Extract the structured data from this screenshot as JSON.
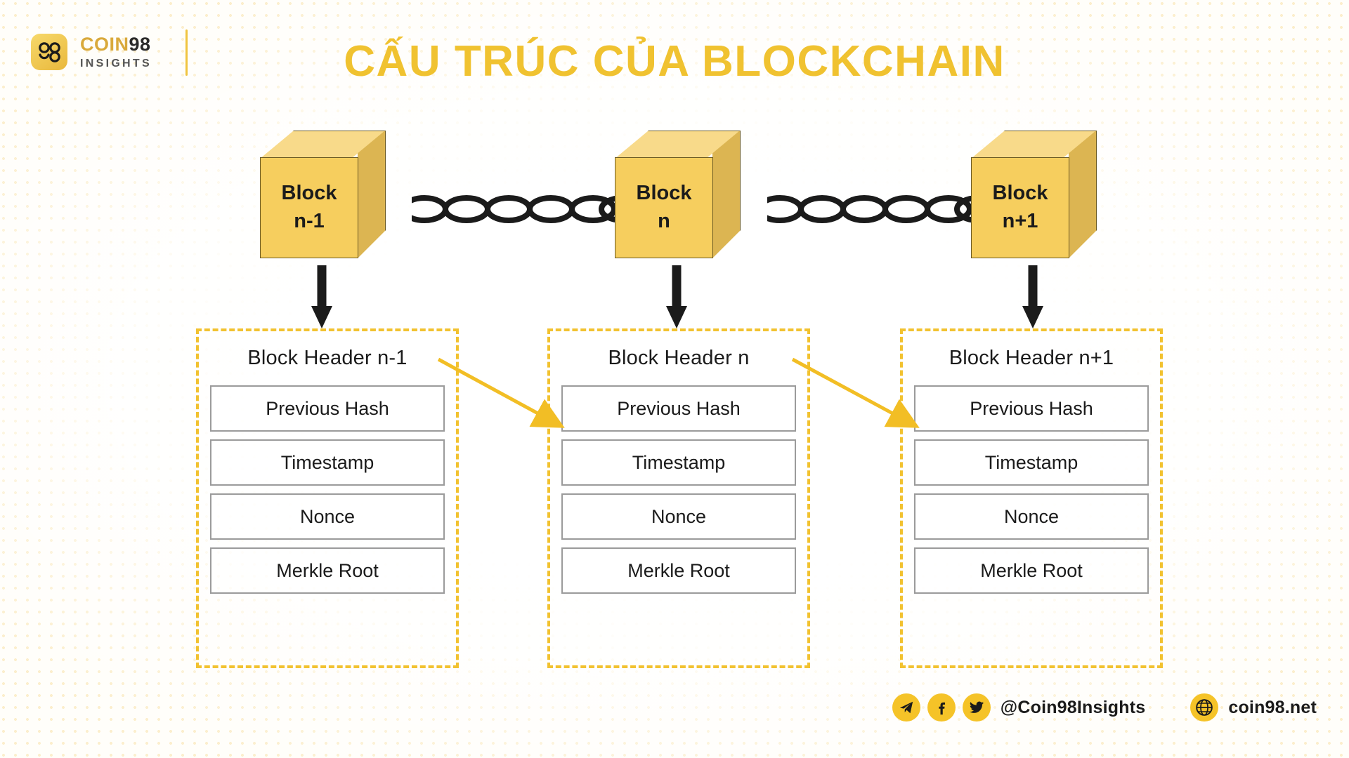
{
  "brand": {
    "logo_title_word": "COIN",
    "logo_title_num": "98",
    "logo_subtitle": "INSIGHTS",
    "logo_glyph": "98"
  },
  "header": {
    "title": "CẤU TRÚC CỦA BLOCKCHAIN"
  },
  "colors": {
    "accent": "#F0C230",
    "block_front": "#F6CE5E",
    "block_top": "#F8DA8A",
    "block_side": "#DCB552",
    "field_border": "#9B9B9B",
    "chain": "#1B1B1B",
    "background": "#FFFEFA"
  },
  "diagram": {
    "blocks": [
      {
        "line1": "Block",
        "line2": "n-1"
      },
      {
        "line1": "Block",
        "line2": "n"
      },
      {
        "line1": "Block",
        "line2": "n+1"
      }
    ],
    "panels": [
      {
        "title": "Block Header n-1",
        "fields": [
          "Previous Hash",
          "Timestamp",
          "Nonce",
          "Merkle Root"
        ]
      },
      {
        "title": "Block Header n",
        "fields": [
          "Previous Hash",
          "Timestamp",
          "Nonce",
          "Merkle Root"
        ]
      },
      {
        "title": "Block Header n+1",
        "fields": [
          "Previous Hash",
          "Timestamp",
          "Nonce",
          "Merkle Root"
        ]
      }
    ]
  },
  "footer": {
    "social_handle": "@Coin98Insights",
    "website": "coin98.net",
    "icons": [
      "telegram-icon",
      "facebook-icon",
      "twitter-icon",
      "globe-icon"
    ]
  }
}
